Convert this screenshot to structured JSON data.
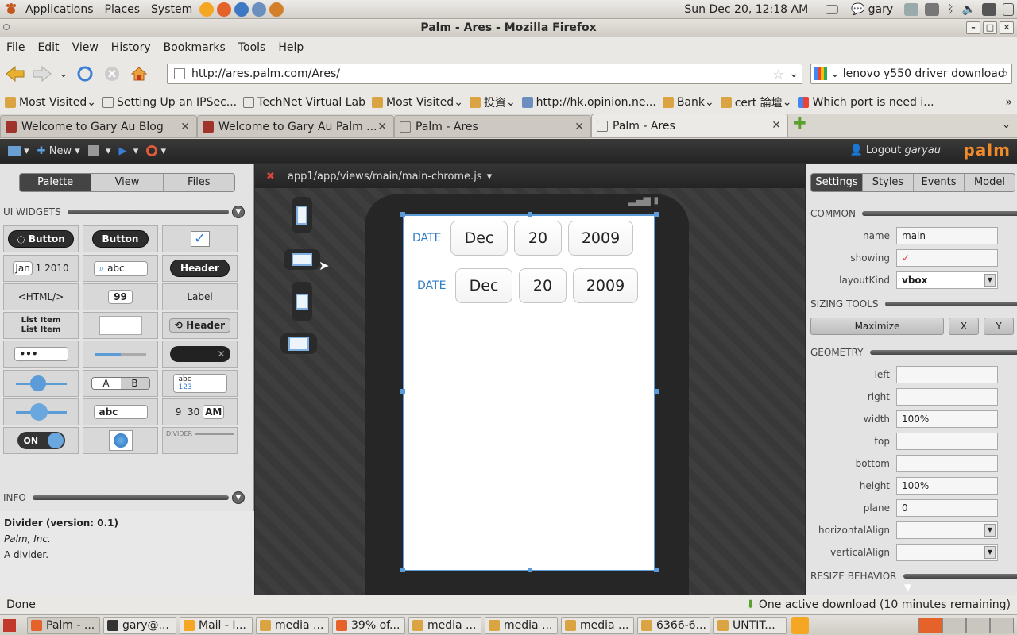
{
  "gnome": {
    "menus": [
      "Applications",
      "Places",
      "System"
    ],
    "clock": "Sun Dec 20, 12:18 AM",
    "user": "gary"
  },
  "window": {
    "title": "Palm - Ares - Mozilla Firefox"
  },
  "menubar": [
    "File",
    "Edit",
    "View",
    "History",
    "Bookmarks",
    "Tools",
    "Help"
  ],
  "nav": {
    "url": "http://ares.palm.com/Ares/",
    "search": "lenovo y550 driver download"
  },
  "bookmarks": [
    "Most Visited",
    "Setting Up an IPSec...",
    "TechNet Virtual Lab",
    "Most Visited",
    "投資",
    "http://hk.opinion.ne...",
    "Bank",
    "cert 論壇",
    "Which port is need i..."
  ],
  "tabs": [
    "Welcome to Gary Au Blog",
    "Welcome to Gary Au Palm ...",
    "Palm - Ares",
    "Palm - Ares"
  ],
  "ares": {
    "toolbar": {
      "new_label": "New",
      "logout": "Logout",
      "user": "garyau",
      "logo": "palm"
    },
    "palette_tabs": [
      "Palette",
      "View",
      "Files"
    ],
    "ui_widgets_header": "UI WIDGETS",
    "widgets": {
      "button1": "Button",
      "button2": "Button",
      "date_jan": "Jan",
      "date_1": "1",
      "date_2010": "2010",
      "search_abc": "abc",
      "header1": "Header",
      "html": "<HTML/>",
      "num99": "99",
      "label": "Label",
      "list_item1": "List Item",
      "list_item2": "List Item",
      "header2": "Header",
      "password": "•••",
      "seg_a": "A",
      "seg_b": "B",
      "rich_abc": "abc",
      "rich_123": "123",
      "text_abc": "abc",
      "time_9": "9",
      "time_30": "30",
      "time_am": "AM",
      "toggle_on": "ON",
      "divider": "DIVIDER"
    },
    "info_header": "INFO",
    "info": {
      "title": "Divider (version: 0.1)",
      "company": "Palm, Inc.",
      "desc": "A divider."
    },
    "file_path": "app1/app/views/main/main-chrome.js",
    "date_pickers": [
      {
        "label": "DATE",
        "month": "Dec",
        "day": "20",
        "year": "2009"
      },
      {
        "label": "DATE",
        "month": "Dec",
        "day": "20",
        "year": "2009"
      }
    ],
    "settings_tabs": [
      "Settings",
      "Styles",
      "Events",
      "Model"
    ],
    "common_header": "COMMON",
    "props_common": [
      {
        "label": "name",
        "value": "main"
      },
      {
        "label": "showing",
        "value": "✓"
      },
      {
        "label": "layoutKind",
        "value": "vbox"
      }
    ],
    "sizing_header": "SIZING TOOLS",
    "sizing_buttons": {
      "maximize": "Maximize",
      "x": "X",
      "y": "Y"
    },
    "geometry_header": "GEOMETRY",
    "props_geometry": [
      {
        "label": "left",
        "value": ""
      },
      {
        "label": "right",
        "value": ""
      },
      {
        "label": "width",
        "value": "100%"
      },
      {
        "label": "top",
        "value": ""
      },
      {
        "label": "bottom",
        "value": ""
      },
      {
        "label": "height",
        "value": "100%"
      },
      {
        "label": "plane",
        "value": "0"
      },
      {
        "label": "horizontalAlign",
        "value": ""
      },
      {
        "label": "verticalAlign",
        "value": ""
      }
    ],
    "resize_header": "RESIZE BEHAVIOR"
  },
  "status": {
    "left": "Done",
    "right": "One active download (10 minutes remaining)"
  },
  "taskbar": [
    "Palm - ...",
    "gary@...",
    "Mail - I...",
    "media ...",
    "39% of...",
    "media ...",
    "media ...",
    "media ...",
    "6366-6...",
    "UNTIT..."
  ],
  "colors": {
    "ares_accent": "#f08a2a",
    "selection_blue": "#5b9bd8",
    "date_label": "#2f7fc6"
  }
}
